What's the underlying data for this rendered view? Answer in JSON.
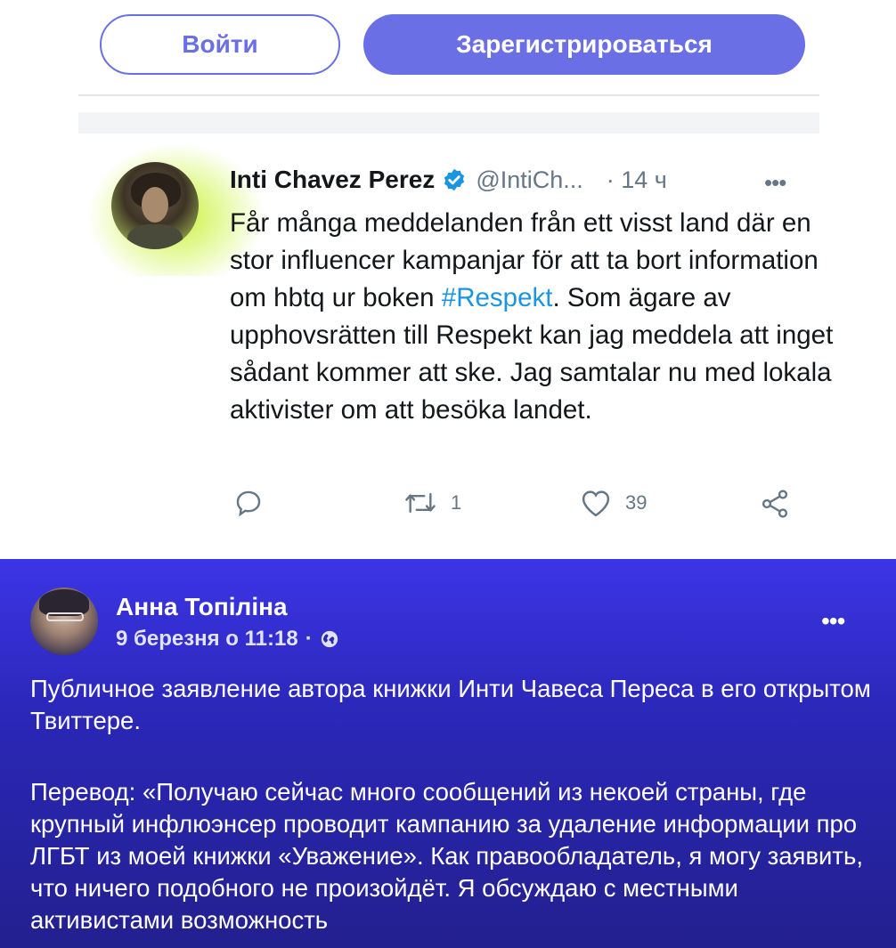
{
  "auth": {
    "login_label": "Войти",
    "register_label": "Зарегистрироваться",
    "accent_color": "#6a6fe6"
  },
  "tweet": {
    "author_name": "Inti Chavez Perez",
    "handle": "@IntiCh...",
    "time": "· 14 ч",
    "more": "•••",
    "verified_icon": "verified-badge-icon",
    "text_before": "Får många meddelanden från ett visst land där en stor influencer kampanjar för att ta bort information om hbtq ur boken ",
    "hashtag": "#Respekt",
    "text_after": ". Som ägare av upphovsrätten till Respekt kan jag meddela att inget sådant kommer att ske. Jag samtalar nu med lokala aktivister om att besöka landet.",
    "hashtag_color": "#1b95e0",
    "actions": {
      "reply_icon": "reply-icon",
      "retweet_icon": "retweet-icon",
      "retweet_count": "1",
      "like_icon": "heart-icon",
      "like_count": "39",
      "share_icon": "share-icon"
    }
  },
  "fb_post": {
    "author_name": "Анна Топіліна",
    "date": "9 березня о 11:18",
    "separator": "·",
    "privacy_icon": "globe-icon",
    "more": "•••",
    "paragraph_1": "Публичное заявление автора книжки Инти Чавеса Переса в его открытом Твиттере.",
    "paragraph_2": "Перевод: «Получаю сейчас много сообщений из некоей страны, где крупный инфлюэнсер проводит кампанию за удаление информации про ЛГБТ из моей книжки «Уважение». Как правообладатель, я могу заявить, что ничего подобного не произойдёт. Я обсуждаю с местными активистами возможность",
    "background_color": "#2b27b8"
  }
}
